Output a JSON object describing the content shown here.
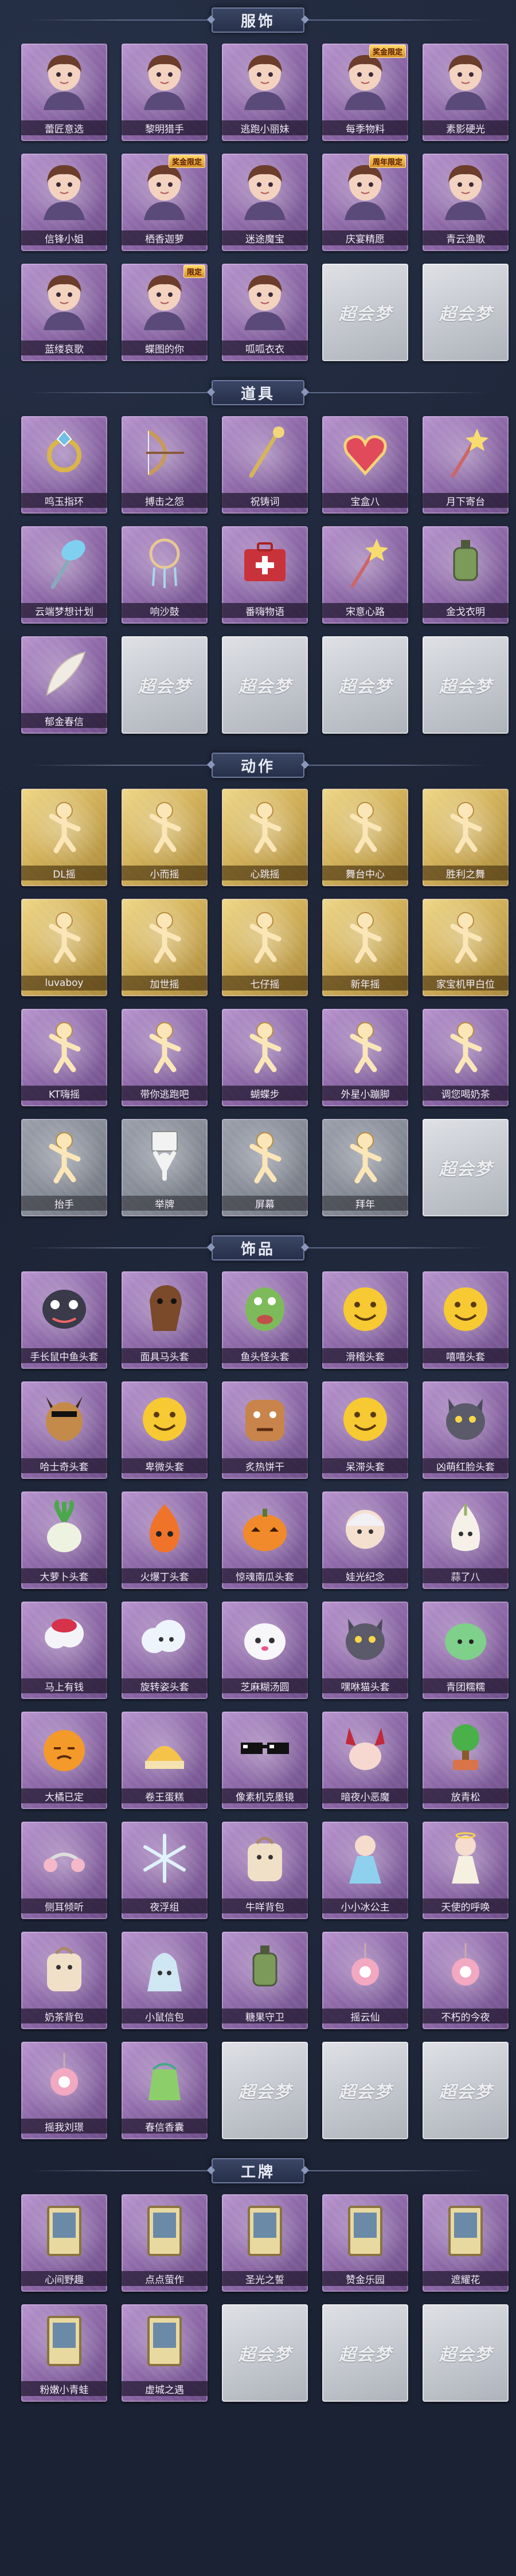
{
  "watermark": "超会梦",
  "sections": [
    {
      "title": "服饰",
      "items": [
        {
          "label": "蕾匠意选",
          "tag": "",
          "icon": "character-portrait-icon"
        },
        {
          "label": "黎明猎手",
          "tag": "",
          "icon": "character-portrait-icon"
        },
        {
          "label": "逃跑小丽妹",
          "tag": "",
          "icon": "character-portrait-icon"
        },
        {
          "label": "每季物料",
          "tag": "奖金限定",
          "icon": "character-portrait-icon"
        },
        {
          "label": "素影硬光",
          "tag": "",
          "icon": "character-portrait-icon"
        },
        {
          "label": "信锋小姐",
          "tag": "",
          "icon": "character-portrait-icon"
        },
        {
          "label": "栖香迦萝",
          "tag": "奖金限定",
          "icon": "character-portrait-icon"
        },
        {
          "label": "迷途魔宝",
          "tag": "",
          "icon": "character-portrait-icon"
        },
        {
          "label": "庆宴精愿",
          "tag": "周年限定",
          "icon": "character-portrait-icon"
        },
        {
          "label": "青云渔歌",
          "tag": "",
          "icon": "character-portrait-icon"
        },
        {
          "label": "蓝缕哀歌",
          "tag": "",
          "icon": "character-portrait-icon"
        },
        {
          "label": "蝶图的你",
          "tag": "限定",
          "icon": "character-portrait-icon"
        },
        {
          "label": "呱呱衣衣",
          "tag": "",
          "icon": "character-portrait-icon"
        }
      ],
      "empty_count": 2
    },
    {
      "title": "道具",
      "items": [
        {
          "label": "鸣玉指环",
          "tag": "",
          "icon": "ring-icon"
        },
        {
          "label": "搏击之怨",
          "tag": "",
          "icon": "bow-icon"
        },
        {
          "label": "祝铸词",
          "tag": "",
          "icon": "staff-icon"
        },
        {
          "label": "宝盒八",
          "tag": "",
          "icon": "heart-locket-icon"
        },
        {
          "label": "月下寄台",
          "tag": "",
          "icon": "wand-icon"
        },
        {
          "label": "云端梦想计划",
          "tag": "",
          "icon": "mallet-icon"
        },
        {
          "label": "响沙鼓",
          "tag": "",
          "icon": "dreamcatcher-icon"
        },
        {
          "label": "番嗨物语",
          "tag": "",
          "icon": "medkit-icon"
        },
        {
          "label": "宋意心路",
          "tag": "",
          "icon": "wand-icon"
        },
        {
          "label": "金戈衣明",
          "tag": "",
          "icon": "lantern-icon"
        },
        {
          "label": "郁金春信",
          "tag": "",
          "icon": "feather-icon"
        }
      ],
      "empty_count": 4
    },
    {
      "title": "动作",
      "items": [
        {
          "label": "DL摇",
          "tag": "",
          "icon": "dance-pose-icon",
          "style": "gold"
        },
        {
          "label": "小而摇",
          "tag": "",
          "icon": "dance-pose-icon",
          "style": "gold"
        },
        {
          "label": "心跳摇",
          "tag": "",
          "icon": "dance-pose-icon",
          "style": "gold"
        },
        {
          "label": "舞台中心",
          "tag": "",
          "icon": "dance-pose-icon",
          "style": "gold"
        },
        {
          "label": "胜利之舞",
          "tag": "",
          "icon": "dance-pose-icon",
          "style": "gold"
        },
        {
          "label": "luvaboy",
          "tag": "",
          "icon": "dance-pose-icon",
          "style": "gold"
        },
        {
          "label": "加世摇",
          "tag": "",
          "icon": "dance-pose-icon",
          "style": "gold"
        },
        {
          "label": "七仔摇",
          "tag": "",
          "icon": "dance-pose-icon",
          "style": "gold"
        },
        {
          "label": "新年摇",
          "tag": "",
          "icon": "dance-pose-icon",
          "style": "gold"
        },
        {
          "label": "家宝机甲白位",
          "tag": "",
          "icon": "dance-pose-icon",
          "style": "gold"
        },
        {
          "label": "KT嗨摇",
          "tag": "",
          "icon": "dance-pose-icon",
          "style": "purple"
        },
        {
          "label": "带你逃跑吧",
          "tag": "",
          "icon": "dance-pose-icon",
          "style": "purple"
        },
        {
          "label": "蝴蝶步",
          "tag": "",
          "icon": "dance-pose-icon",
          "style": "purple"
        },
        {
          "label": "外星小蹦脚",
          "tag": "",
          "icon": "dance-pose-icon",
          "style": "purple"
        },
        {
          "label": "调您喝奶茶",
          "tag": "",
          "icon": "dance-pose-icon",
          "style": "purple"
        },
        {
          "label": "抬手",
          "tag": "",
          "icon": "dance-pose-icon",
          "style": "gray"
        },
        {
          "label": "举牌",
          "tag": "",
          "icon": "sign-pose-icon",
          "style": "gray"
        },
        {
          "label": "屏幕",
          "tag": "",
          "icon": "dance-pose-icon",
          "style": "gray"
        },
        {
          "label": "拜年",
          "tag": "",
          "icon": "dance-pose-icon",
          "style": "gray"
        }
      ],
      "empty_count": 1
    },
    {
      "title": "饰品",
      "items": [
        {
          "label": "手长鼠中鱼头套",
          "tag": "",
          "icon": "mask-icon"
        },
        {
          "label": "面具马头套",
          "tag": "",
          "icon": "horse-head-icon"
        },
        {
          "label": "鱼头怪头套",
          "tag": "",
          "icon": "fish-head-icon"
        },
        {
          "label": "滑稽头套",
          "tag": "",
          "icon": "emoji-face-icon"
        },
        {
          "label": "嘻嘻头套",
          "tag": "",
          "icon": "emoji-face-icon"
        },
        {
          "label": "哈士奇头套",
          "tag": "",
          "icon": "dog-head-icon"
        },
        {
          "label": "卑微头套",
          "tag": "",
          "icon": "emoji-face-icon"
        },
        {
          "label": "炙热饼干",
          "tag": "",
          "icon": "cookie-head-icon"
        },
        {
          "label": "呆滞头套",
          "tag": "",
          "icon": "emoji-face-icon"
        },
        {
          "label": "凶萌红脸头套",
          "tag": "",
          "icon": "cat-head-icon"
        },
        {
          "label": "大萝卜头套",
          "tag": "",
          "icon": "radish-head-icon"
        },
        {
          "label": "火爆丁头套",
          "tag": "",
          "icon": "fire-head-icon"
        },
        {
          "label": "惊魂南瓜头套",
          "tag": "",
          "icon": "pumpkin-head-icon"
        },
        {
          "label": "娃光纪念",
          "tag": "",
          "icon": "doll-head-icon"
        },
        {
          "label": "蒜了八",
          "tag": "",
          "icon": "garlic-head-icon"
        },
        {
          "label": "马上有钱",
          "tag": "",
          "icon": "cloud-hat-icon"
        },
        {
          "label": "旋转姿头套",
          "tag": "",
          "icon": "cloud-head-icon"
        },
        {
          "label": "芝麻糊汤圆",
          "tag": "",
          "icon": "dumpling-head-icon"
        },
        {
          "label": "嘿咻猫头套",
          "tag": "",
          "icon": "cat-head-icon"
        },
        {
          "label": "青团糯糯",
          "tag": "",
          "icon": "bun-head-icon"
        },
        {
          "label": "大橘已定",
          "tag": "",
          "icon": "orange-head-icon"
        },
        {
          "label": "卷王蛋糕",
          "tag": "",
          "icon": "cake-hat-icon"
        },
        {
          "label": "像素机克墨镜",
          "tag": "",
          "icon": "sunglasses-icon"
        },
        {
          "label": "暗夜小恶魔",
          "tag": "",
          "icon": "devil-horns-icon"
        },
        {
          "label": "放青松",
          "tag": "",
          "icon": "tree-hat-icon"
        },
        {
          "label": "侧耳倾听",
          "tag": "",
          "icon": "ear-accessory-icon"
        },
        {
          "label": "夜浮组",
          "tag": "",
          "icon": "snowflake-accessory-icon"
        },
        {
          "label": "牛咩背包",
          "tag": "",
          "icon": "backpack-icon"
        },
        {
          "label": "小小冰公主",
          "tag": "",
          "icon": "doll-icon"
        },
        {
          "label": "天使的呼唤",
          "tag": "",
          "icon": "angel-doll-icon"
        },
        {
          "label": "奶茶背包",
          "tag": "",
          "icon": "backpack-icon"
        },
        {
          "label": "小鼠信包",
          "tag": "",
          "icon": "bag-icon"
        },
        {
          "label": "糖果守卫",
          "tag": "",
          "icon": "lantern-icon"
        },
        {
          "label": "摇云仙",
          "tag": "",
          "icon": "charm-icon"
        },
        {
          "label": "不朽的今夜",
          "tag": "",
          "icon": "charm-icon"
        },
        {
          "label": "摇我刘璟",
          "tag": "",
          "icon": "charm-icon"
        },
        {
          "label": "春信香囊",
          "tag": "",
          "icon": "sachet-icon"
        }
      ],
      "empty_count": 3
    },
    {
      "title": "工牌",
      "items": [
        {
          "label": "心间野趣",
          "tag": "",
          "icon": "badge-card-icon"
        },
        {
          "label": "点点萤作",
          "tag": "",
          "icon": "badge-card-icon"
        },
        {
          "label": "圣光之誓",
          "tag": "",
          "icon": "badge-card-icon"
        },
        {
          "label": "赞金乐园",
          "tag": "",
          "icon": "badge-card-icon"
        },
        {
          "label": "遮耀花",
          "tag": "",
          "icon": "badge-card-icon"
        },
        {
          "label": "粉嫩小青蛙",
          "tag": "",
          "icon": "badge-card-icon"
        },
        {
          "label": "虚城之遇",
          "tag": "",
          "icon": "badge-card-icon"
        }
      ],
      "empty_count": 3
    }
  ]
}
